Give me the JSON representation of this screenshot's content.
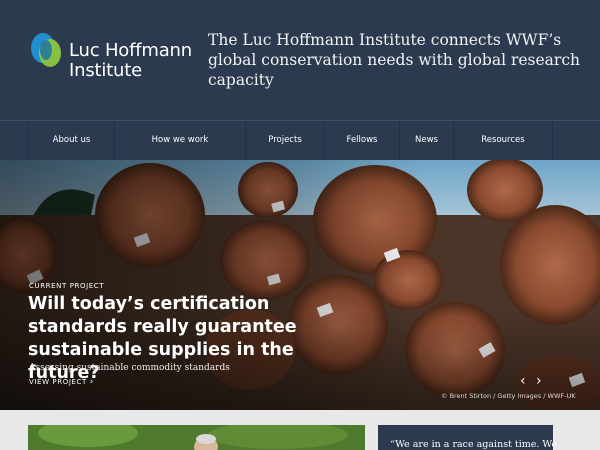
{
  "header": {
    "logo_line1": "Luc Hoffmann",
    "logo_line2": "Institute",
    "tagline": "The Luc Hoffmann Institute connects WWF’s global conservation needs with global research capacity"
  },
  "nav": {
    "items": [
      {
        "label": "About us"
      },
      {
        "label": "How we work"
      },
      {
        "label": "Projects"
      },
      {
        "label": "Fellows"
      },
      {
        "label": "News"
      },
      {
        "label": "Resources"
      }
    ]
  },
  "hero": {
    "kicker": "CURRENT PROJECT",
    "headline": "Will today’s certification standards really guarantee sustainable supplies in the future?",
    "subtitle": "Assessing sustainable commodity standards",
    "view_link": "VIEW PROJECT",
    "prev_icon": "chevron-left-icon",
    "next_icon": "chevron-right-icon",
    "credit": "© Brent Stirton / Getty Images / WWF-UK"
  },
  "content": {
    "quote": "“We are in a race against time. We"
  },
  "colors": {
    "navy": "#2c3a4f",
    "logo_blue": "#1f8fd0",
    "logo_green": "#8dc63f"
  }
}
